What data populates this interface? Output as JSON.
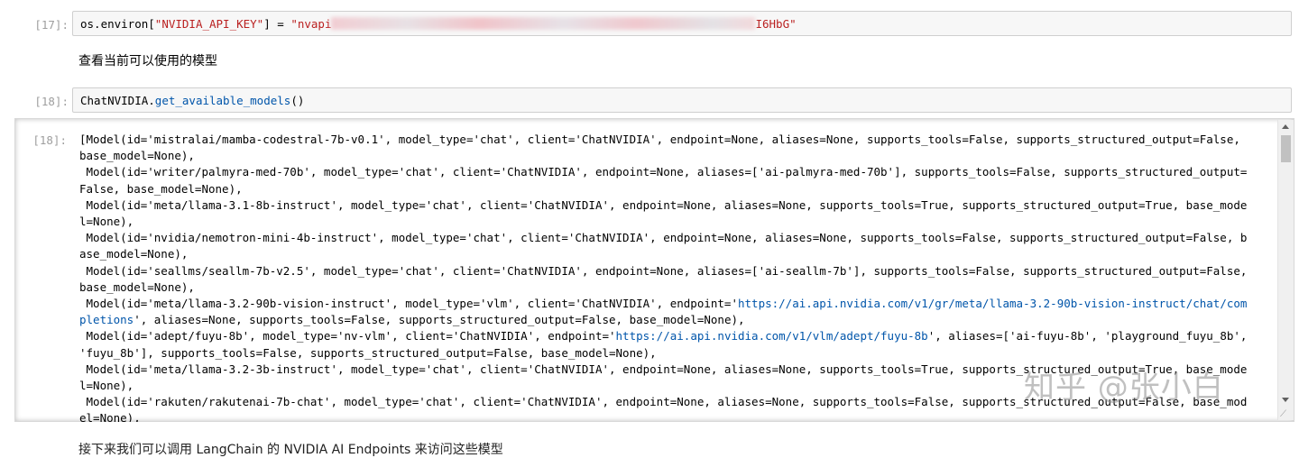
{
  "cell17": {
    "prompt": "[17]:",
    "code_prefix": "os.",
    "code_attr": "environ",
    "code_open": "[",
    "code_key": "\"NVIDIA_API_KEY\"",
    "code_mid": "] = ",
    "code_val_start": "\"nvapi",
    "code_val_end": "I6HbG\""
  },
  "markdown1": {
    "text": "查看当前可以使用的模型"
  },
  "cell18_in": {
    "prompt": "[18]:",
    "code_obj": "ChatNVIDIA.",
    "code_fn": "get_available_models",
    "code_paren": "()"
  },
  "cell18_out": {
    "prompt": "[18]:",
    "lines": [
      "[Model(id='mistralai/mamba-codestral-7b-v0.1', model_type='chat', client='ChatNVIDIA', endpoint=None, aliases=None, supports_tools=False, supports_structured_output=False,",
      "base_model=None),",
      " Model(id='writer/palmyra-med-70b', model_type='chat', client='ChatNVIDIA', endpoint=None, aliases=['ai-palmyra-med-70b'], supports_tools=False, supports_structured_output=",
      "False, base_model=None),",
      " Model(id='meta/llama-3.1-8b-instruct', model_type='chat', client='ChatNVIDIA', endpoint=None, aliases=None, supports_tools=True, supports_structured_output=True, base_mode",
      "l=None),",
      " Model(id='nvidia/nemotron-mini-4b-instruct', model_type='chat', client='ChatNVIDIA', endpoint=None, aliases=None, supports_tools=False, supports_structured_output=False, b",
      "ase_model=None),",
      " Model(id='seallms/seallm-7b-v2.5', model_type='chat', client='ChatNVIDIA', endpoint=None, aliases=['ai-seallm-7b'], supports_tools=False, supports_structured_output=False,",
      "base_model=None),"
    ],
    "vision_line_pre": " Model(id='meta/llama-3.2-90b-vision-instruct', model_type='vlm', client='ChatNVIDIA', endpoint='",
    "vision_url_a": "https://ai.api.nvidia.com/v1/gr/meta/llama-3.2-90b-vision-instruct/chat/com",
    "vision_url_b": "pletions",
    "vision_line2_rest": "', aliases=None, supports_tools=False, supports_structured_output=False, base_model=None),",
    "fuyu_pre": " Model(id='adept/fuyu-8b', model_type='nv-vlm', client='ChatNVIDIA', endpoint='",
    "fuyu_url": "https://ai.api.nvidia.com/v1/vlm/adept/fuyu-8b",
    "fuyu_post": "', aliases=['ai-fuyu-8b', 'playground_fuyu_8b',",
    "fuyu_line2": "'fuyu_8b'], supports_tools=False, supports_structured_output=False, base_model=None),",
    "tail_lines": [
      " Model(id='meta/llama-3.2-3b-instruct', model_type='chat', client='ChatNVIDIA', endpoint=None, aliases=None, supports_tools=True, supports_structured_output=True, base_mode",
      "l=None),",
      " Model(id='rakuten/rakutenai-7b-chat', model_type='chat', client='ChatNVIDIA', endpoint=None, aliases=None, supports_tools=False, supports_structured_output=False, base_mod",
      "el=None),"
    ]
  },
  "watermark": {
    "text": "知乎 @张小白"
  },
  "bottom": {
    "text": "接下来我们可以调用 LangChain 的 NVIDIA AI Endpoints 来访问这些模型"
  }
}
